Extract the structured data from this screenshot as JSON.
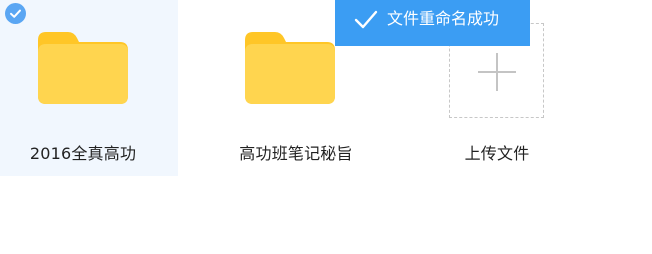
{
  "items": [
    {
      "label": "2016全真高功",
      "type": "folder",
      "selected": true
    },
    {
      "label": "高功班笔记秘旨",
      "type": "folder",
      "selected": false
    },
    {
      "label": "上传文件",
      "type": "upload",
      "selected": false
    }
  ],
  "toast": {
    "message": "文件重命名成功",
    "icon": "check-icon"
  },
  "colors": {
    "folder_body": "#ffd54f",
    "folder_tab": "#ffc627",
    "selected_bg": "#f1f7fe",
    "toast_bg": "#3b9df3",
    "badge": "#5aa6f3"
  }
}
